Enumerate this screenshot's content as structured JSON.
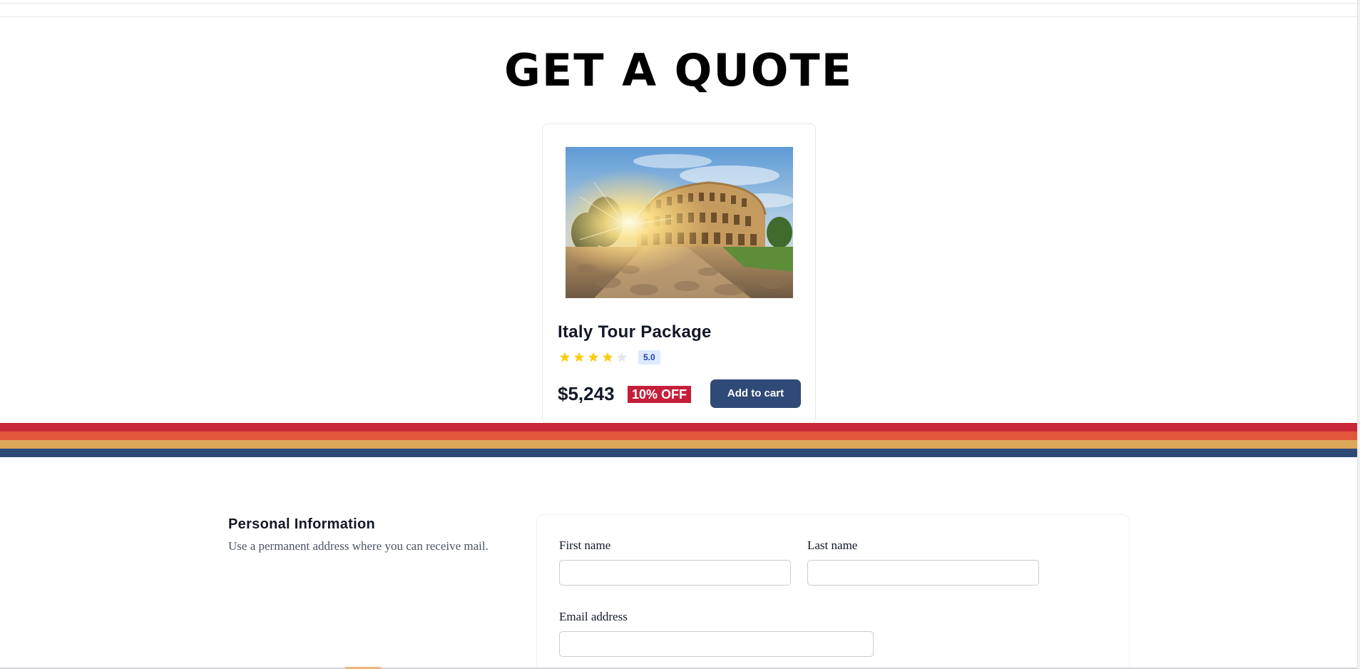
{
  "page": {
    "title": "GET A QUOTE"
  },
  "product": {
    "image_alt": "Colosseum in Rome at sunrise",
    "name": "Italy Tour Package",
    "rating": "5.0",
    "stars_filled": 4,
    "stars_total": 5,
    "price": "$5,243",
    "discount": "10% OFF",
    "add_to_cart_label": "Add to cart"
  },
  "stripes": {
    "colors": [
      "#c8283a",
      "#e0563a",
      "#dda75a",
      "#2f4a77"
    ]
  },
  "personal_info": {
    "heading": "Personal Information",
    "description": "Use a permanent address where you can receive mail.",
    "fields": {
      "first_name_label": "First name",
      "first_name_value": "",
      "last_name_label": "Last name",
      "last_name_value": "",
      "email_label": "Email address",
      "email_value": ""
    }
  },
  "colors": {
    "brand_navy": "#2f4a77",
    "discount_red": "#c41e3a",
    "star_filled": "#facc15",
    "star_empty": "#e5e7eb",
    "rating_badge_bg": "#dbeafe"
  }
}
